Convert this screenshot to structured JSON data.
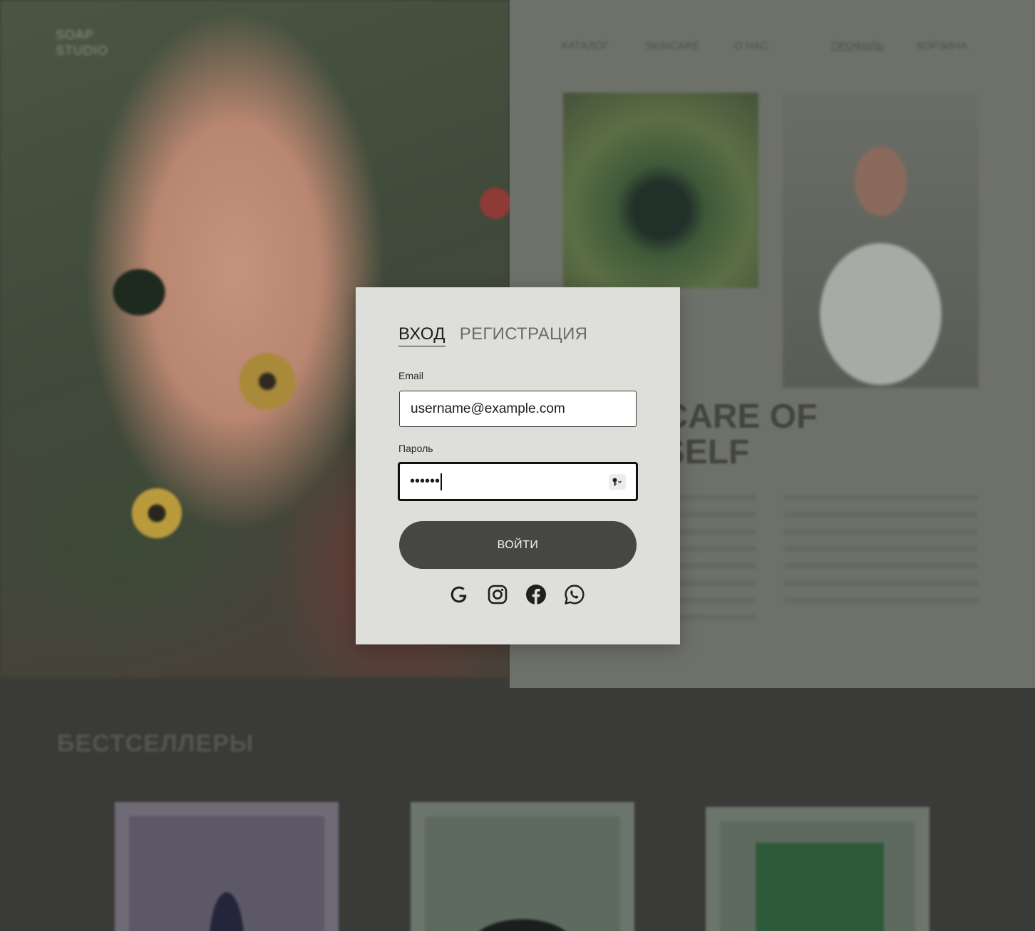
{
  "background": {
    "logo": "SOAP STUDIO",
    "nav": {
      "catalog": "КАТАЛОГ",
      "skincare": "SKINCARE",
      "about": "О НАС",
      "profile": "ПРОФИЛЬ",
      "cart": "КОРЗИНА"
    },
    "headline": "TAKE CARE OF YOURSELF",
    "bestsellers_title": "БЕСТСЕЛЛЕРЫ"
  },
  "modal": {
    "tabs": [
      {
        "label": "ВХОД",
        "active": true
      },
      {
        "label": "РЕГИСТРАЦИЯ",
        "active": false
      }
    ],
    "email_label": "Email",
    "email_value": "username@example.com",
    "password_label": "Пароль",
    "password_value": "••••••",
    "login_button": "ВОЙТИ",
    "socials": [
      "google-icon",
      "instagram-icon",
      "facebook-icon",
      "whatsapp-icon"
    ]
  },
  "colors": {
    "overlay_bg": "#3b3b39",
    "modal_bg": "#dedfda",
    "button_bg": "#464742",
    "text_dark": "#1d1d1b"
  }
}
